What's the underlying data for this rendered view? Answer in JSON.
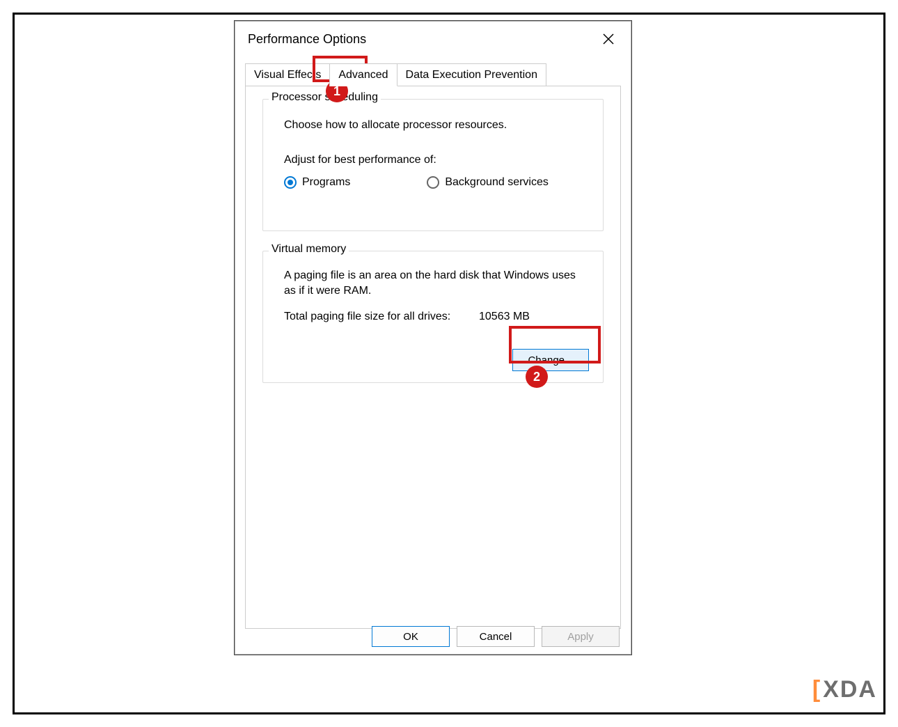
{
  "dialog": {
    "title": "Performance Options",
    "tabs": {
      "visual_effects": "Visual Effects",
      "advanced": "Advanced",
      "dep": "Data Execution Prevention",
      "active": "advanced"
    }
  },
  "processor_scheduling": {
    "legend": "Processor scheduling",
    "description": "Choose how to allocate processor resources.",
    "adjust_label": "Adjust for best performance of:",
    "options": {
      "programs": "Programs",
      "background": "Background services",
      "selected": "programs"
    }
  },
  "virtual_memory": {
    "legend": "Virtual memory",
    "description": "A paging file is an area on the hard disk that Windows uses as if it were RAM.",
    "total_label": "Total paging file size for all drives:",
    "total_value": "10563 MB",
    "change_label": "Change..."
  },
  "footer": {
    "ok": "OK",
    "cancel": "Cancel",
    "apply": "Apply"
  },
  "annotations": {
    "badge1": "1",
    "badge2": "2"
  },
  "watermark": {
    "bracket": "[",
    "text": "XDA"
  }
}
